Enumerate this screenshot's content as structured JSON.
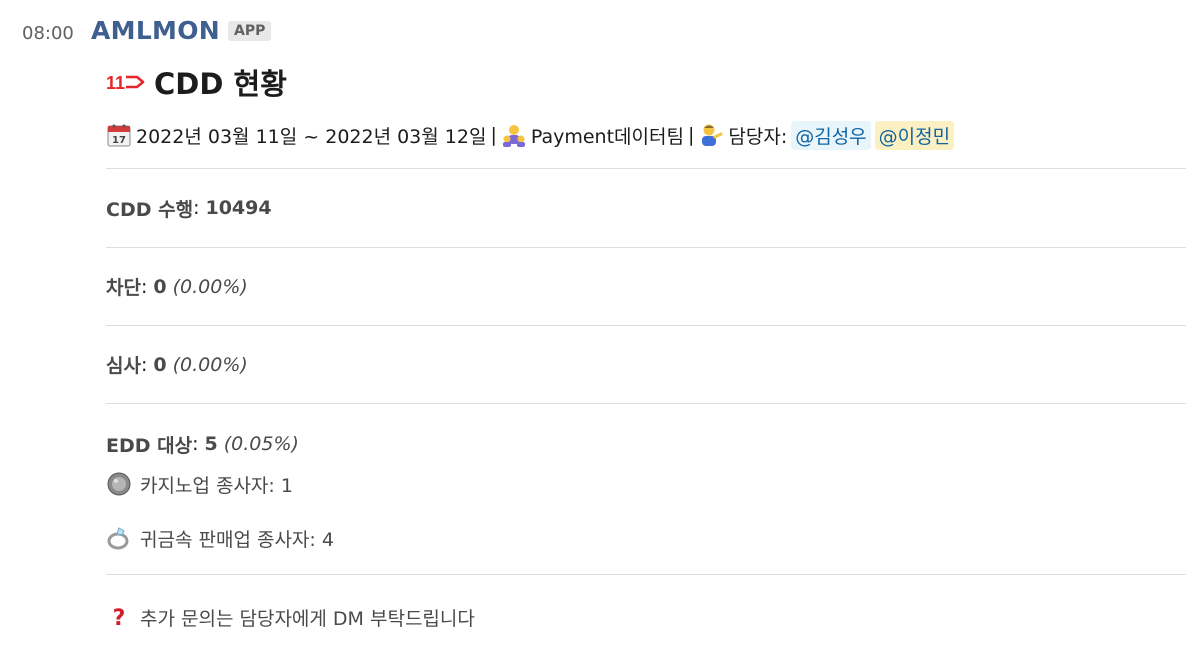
{
  "message": {
    "time": "08:00",
    "sender": "AMLMON",
    "badge": "APP"
  },
  "report": {
    "logo_icon": "red-11-arrow-logo-icon",
    "title": "CDD 현황",
    "period": "2022년 03월 11일 ~ 2022년 03월 12일",
    "sep1": "|",
    "team": "Payment데이터팀",
    "sep2": "|",
    "owner_label": "담당자:",
    "mentions": [
      "@김성우",
      "@이정민"
    ],
    "cdd_label": "CDD 수행",
    "cdd_value": "10494",
    "block_label": "차단",
    "block_value": "0",
    "block_pct": "(0.00%)",
    "review_label": "심사",
    "review_value": "0",
    "review_pct": "(0.00%)",
    "edd_label": "EDD 대상",
    "edd_value": "5",
    "edd_pct": "(0.05%)",
    "casino_text": "카지노업 종사자: 1",
    "metal_text": "귀금속 판매업 종사자: 4",
    "footer_text": "추가 문의는 담당자에게 DM 부탁드립니다",
    "colon": ":"
  },
  "icons": {
    "calendar": "calendar-icon",
    "team": "team-people-icon",
    "owner": "person-tipping-hand-icon",
    "casino": "coin-icon",
    "ring": "ring-icon",
    "question": "red-question-mark-icon"
  },
  "colors": {
    "sender": "#3f5f8f",
    "mention": "#1264a3",
    "logo": "#e8262a"
  }
}
